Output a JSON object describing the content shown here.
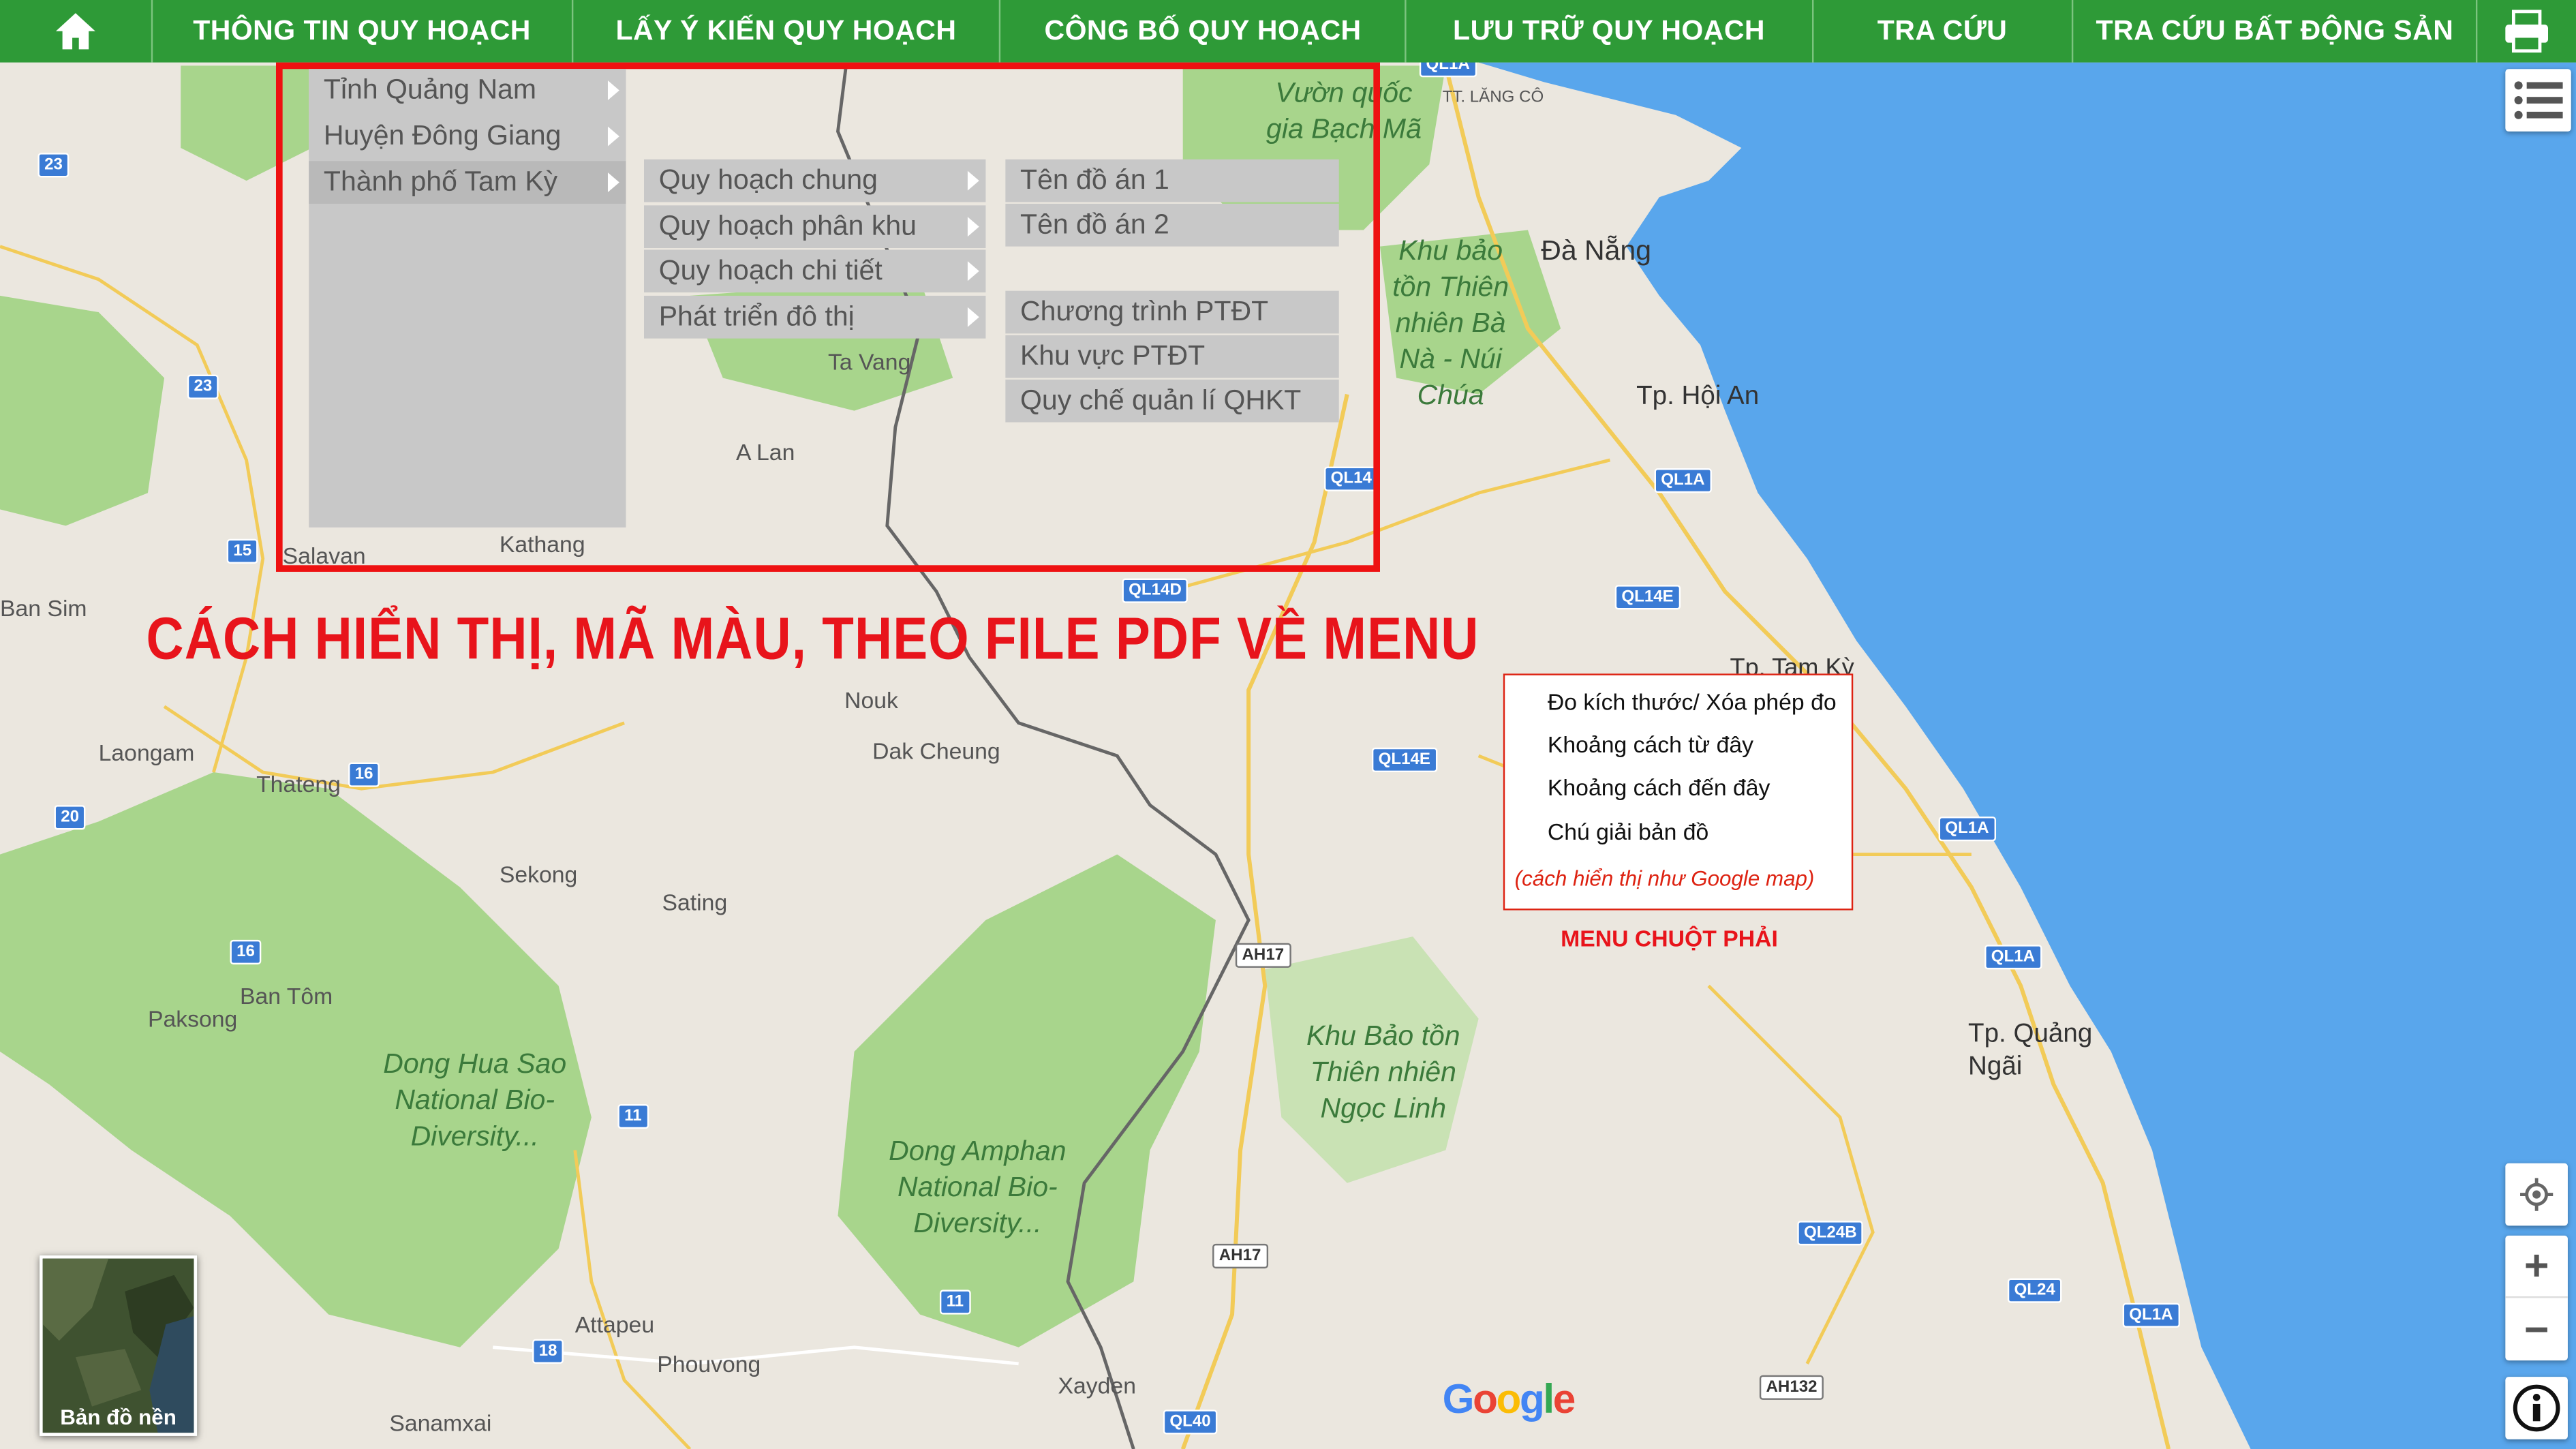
{
  "nav": {
    "items": [
      {
        "label": "THÔNG TIN QUY HOẠCH"
      },
      {
        "label": "LẤY Ý KIẾN QUY HOẠCH"
      },
      {
        "label": "CÔNG BỐ QUY HOẠCH"
      },
      {
        "label": "LƯU TRỮ QUY HOẠCH"
      },
      {
        "label": "TRA CỨU"
      },
      {
        "label": "TRA CỨU BẤT ĐỘNG SẢN"
      }
    ],
    "home_icon": "home-icon",
    "print_icon": "printer-icon"
  },
  "colors": {
    "nav_bg": "#2e9a37",
    "annotation_red": "#e8141b",
    "menu_bg": "#c8c8c8",
    "map_bg": "#e9e5dc",
    "sea": "#59a6ec",
    "park": "#a8d58c"
  },
  "menu": {
    "level1": [
      {
        "label": "Tỉnh Quảng Nam"
      },
      {
        "label": "Huyện Đông Giang"
      },
      {
        "label": "Thành phố Tam Kỳ"
      }
    ],
    "level2": [
      {
        "label": "Quy hoạch chung"
      },
      {
        "label": "Quy hoạch phân khu"
      },
      {
        "label": "Quy hoạch chi tiết"
      },
      {
        "label": "Phát triển đô thị"
      }
    ],
    "level3_a": [
      {
        "label": "Tên đồ án 1"
      },
      {
        "label": "Tên đồ án 2"
      }
    ],
    "level3_b": [
      {
        "label": "Chương trình PTĐT"
      },
      {
        "label": "Khu vực PTĐT"
      },
      {
        "label": "Quy chế quản lí QHKT"
      }
    ]
  },
  "annotation": {
    "menu_note": "CÁCH HIỂN THỊ, MÃ MÀU, THEO FILE PDF VỀ MENU",
    "context_menu_caption": "MENU CHUỘT PHẢI"
  },
  "context_menu": {
    "items": [
      {
        "label": "Đo kích thước/ Xóa phép đo"
      },
      {
        "label": "Khoảng cách từ đây"
      },
      {
        "label": "Khoảng cách đến đây"
      },
      {
        "label": "Chú giải bản đồ"
      }
    ],
    "note": "(cách hiển thị như Google map)"
  },
  "controls": {
    "layers_icon": "list-icon",
    "locate_icon": "locate-icon",
    "zoom_in_label": "+",
    "zoom_out_label": "−",
    "info_icon": "info-icon"
  },
  "basemap": {
    "label": "Bản đồ nền"
  },
  "map": {
    "attribution": "Google",
    "labels": [
      {
        "text": "Đà Nẵng",
        "kind": "city"
      },
      {
        "text": "Tp. Hội An",
        "kind": "city"
      },
      {
        "text": "Tp. Tam Kỳ",
        "kind": "city"
      },
      {
        "text": "Tp. Quảng Ngãi",
        "kind": "city"
      },
      {
        "text": "TT. LĂNG CÔ",
        "kind": "town"
      },
      {
        "text": "Ta Vang",
        "kind": "town"
      },
      {
        "text": "A Lan",
        "kind": "town"
      },
      {
        "text": "Kathang",
        "kind": "town"
      },
      {
        "text": "Salavan",
        "kind": "town"
      },
      {
        "text": "Ban Sim",
        "kind": "town"
      },
      {
        "text": "Nouk",
        "kind": "town"
      },
      {
        "text": "Dak Cheung",
        "kind": "town"
      },
      {
        "text": "Laongam",
        "kind": "town"
      },
      {
        "text": "Thateng",
        "kind": "town"
      },
      {
        "text": "Sekong",
        "kind": "town"
      },
      {
        "text": "Sating",
        "kind": "town"
      },
      {
        "text": "Ban Tôm",
        "kind": "town"
      },
      {
        "text": "Paksong",
        "kind": "town"
      },
      {
        "text": "Attapeu",
        "kind": "town"
      },
      {
        "text": "Phouvong",
        "kind": "town"
      },
      {
        "text": "Sanamxai",
        "kind": "town"
      },
      {
        "text": "Xayden",
        "kind": "town"
      },
      {
        "text": "Vườn quốc gia Bạch Mã",
        "kind": "park"
      },
      {
        "text": "Khu bảo tồn Thiên nhiên Bà Nà - Núi Chúa",
        "kind": "park"
      },
      {
        "text": "Khu Bảo tồn Thiên nhiên Ngọc Linh",
        "kind": "park"
      },
      {
        "text": "Dong Hua Sao National Bio-Diversity...",
        "kind": "park"
      },
      {
        "text": "Dong Amphan National Bio-Diversity...",
        "kind": "park"
      }
    ],
    "shields": [
      "QL1A",
      "QL14",
      "QL14D",
      "QL14E",
      "QL24B",
      "QL24",
      "QL40",
      "AH17",
      "AH132",
      "23",
      "15",
      "16",
      "20",
      "11",
      "18"
    ]
  }
}
